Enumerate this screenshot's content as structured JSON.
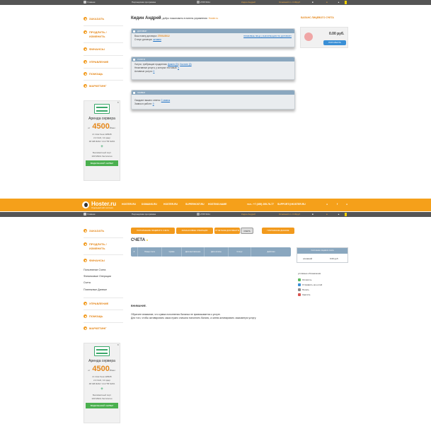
{
  "topbar": {
    "home": "Главная",
    "partner": "Партнерская программа",
    "phone": "2765 5011",
    "user": "Кидин Андрей",
    "balance": "Основной сч. 0.00руб"
  },
  "hostbar": {
    "logo": "Hoster.ru",
    "logo_sub": "Отдельный сайт хостинга",
    "links": [
      "HOSTER.RU",
      "DOMAINS.RU",
      "HOSTER.RU",
      "SUPERHOST.RU",
      "HOSTING.NAME",
      "SITE-BUILDER.RU"
    ],
    "phone": "тел.: +7 (495) 255-76-77",
    "email": "SUPPORT@HOSTER.RU"
  },
  "sidebar": {
    "items": [
      "ЗАКАЗАТЬ",
      "ПРОДЛИТЬ /",
      "ИЗМЕНИТЬ",
      "ФИНАНСЫ",
      "УПРАВЛЕНИЕ",
      "ПОМОЩЬ",
      "МАРКЕТИНГ"
    ],
    "finance_sub": [
      "Пополнение Счета",
      "Финансовые Операции",
      "Счета",
      "Платежные Данные"
    ]
  },
  "ad": {
    "title": "Аренда сервера",
    "from": "от",
    "price": "4500",
    "per": "₽/мес.",
    "spec1": "2× Intel Xeon E5645",
    "spec2": "2-4 GHz, 12 ядер",
    "spec3": "48 GB RAM / 4×2 TB SATA",
    "spec4": "Безлимитный порт",
    "spec5": "100 Mbit/s бесплатно",
    "btn": "ВЫДЕЛЕННЫЙ СЕРВЕР",
    "close": "✕"
  },
  "dash": {
    "greeting_name": "Кидин Андрей",
    "greeting_text": ", добро пожаловать в панель управления",
    "greeting_link": "Hoster.ru",
    "panel1_head": "ДОГОВОР",
    "contract_label": "Ваш номер договора:",
    "contract_num": "27001/2012",
    "contract_status_label": "Статус договора:",
    "contract_status": "активен",
    "contract_links": "ПРАВОВЫЕ ЛИЦА | ИНФОРМАЦИЯ ПО ДОГОВОРУ",
    "panel2_head": "УСЛУГИ",
    "svc1": "Услуги, требующие продления:",
    "svc1_a": "Домен (0)",
    "svc1_b": "Хостинг (0)",
    "svc2": "Неактивные услуги, у которых тестовый:",
    "svc2_v": "0",
    "svc3": "Активные услуги:",
    "svc3_v": "0",
    "panel3_head": "ЗАЯВКИ",
    "req1": "Ожидают вашего ответа:",
    "req1_v": "0 заявок",
    "req2": "Заявок в работе:",
    "req2_v": "0",
    "balance_title": "БАЛАНС ЛИЦЕВОГО СЧЕТА",
    "balance_value": "0.00 руб.",
    "balance_btn": "ПОПОЛНИТЬ"
  },
  "invoices": {
    "tabs": [
      "ПОПОЛНЕНИЕ ЛИЦЕВОГО СЧЕТА",
      "ФИНАНСОВЫЕ ОПЕРАЦИИ",
      "ОТЧЕТНЫЕ ДОКУМЕНТЫ",
      "СЧЕТА"
    ],
    "tab_right": "ПЛАТЕЖНЫЕ ДАННЫЕ",
    "heading": "СЧЕТА",
    "columns": [
      "#",
      "Номер счета",
      "Сумма",
      "Дата выставления",
      "Дата оплаты",
      "Статус",
      "Действия"
    ],
    "acc_head": "Состояние лицевого счета",
    "acc_name": "основной",
    "acc_value": "0.00 руб",
    "legend_title": "условные обозначения",
    "legend": [
      "Оплатить",
      "Отправить на e-mail",
      "Печать",
      "Удалить"
    ],
    "warn_title": "ВНИМАНИЕ.",
    "warn1": "Обратите внимание, что сумма пополнения баланса не привязывается к услуге.",
    "warn2": "Для того, чтобы активировать заказ нужно сначала пополнить баланс, а затем активировать заказанную услугу."
  },
  "colors": {
    "accent": "#f29a1d",
    "header_grid": "#8aa7bf",
    "topbar": "#555555"
  }
}
